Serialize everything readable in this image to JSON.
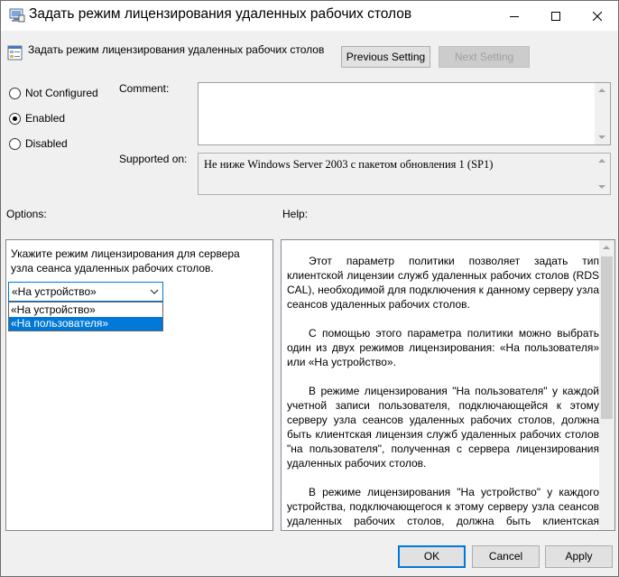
{
  "window": {
    "title": "Задать режим лицензирования удаленных рабочих столов",
    "header_text": "Задать режим лицензирования удаленных рабочих столов"
  },
  "nav": {
    "previous_label": "Previous Setting",
    "next_label": "Next Setting"
  },
  "state": {
    "options": [
      {
        "label": "Not Configured",
        "checked": false
      },
      {
        "label": "Enabled",
        "checked": true
      },
      {
        "label": "Disabled",
        "checked": false
      }
    ]
  },
  "comment": {
    "label": "Comment:",
    "value": ""
  },
  "supported": {
    "label": "Supported on:",
    "value": "Не ниже Windows Server 2003 с пакетом обновления 1 (SP1)"
  },
  "options_panel": {
    "label": "Options:",
    "description": "Укажите режим лицензирования для сервера узла сеанса удаленных рабочих столов.",
    "combo_value": "«На устройство»",
    "dropdown_items": [
      "«На устройство»",
      "«На пользователя»"
    ]
  },
  "help_panel": {
    "label": "Help:",
    "paragraphs": [
      "Этот параметр политики позволяет задать тип клиентской лицензии служб удаленных рабочих столов (RDS CAL), необходимой для подключения к данному серверу узла сеансов удаленных рабочих столов.",
      "С помощью этого параметра политики можно выбрать один из двух режимов лицензирования: «На пользователя» или «На устройство».",
      "В режиме лицензирования \"На пользователя\" у каждой учетной записи пользователя, подключающейся к этому серверу узла сеансов удаленных рабочих столов, должна быть клиентская лицензия служб удаленных рабочих столов \"на пользователя\", полученная с сервера лицензирования удаленных рабочих столов.",
      "В режиме лицензирования \"На устройство\" у каждого устройства, подключающегося к этому серверу узла сеансов удаленных рабочих столов, должна быть клиентская лицензия служб удаленных рабочих столов \"на устройство\","
    ]
  },
  "buttons": {
    "ok": "OK",
    "cancel": "Cancel",
    "apply": "Apply"
  }
}
